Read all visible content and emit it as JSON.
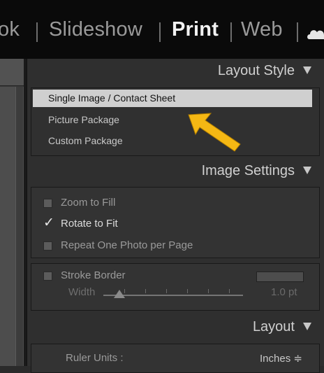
{
  "modules": [
    "ok",
    "Slideshow",
    "Print",
    "Web"
  ],
  "active_module": "Print",
  "layout_style": {
    "title": "Layout Style",
    "items": [
      "Single Image / Contact Sheet",
      "Picture Package",
      "Custom Package"
    ],
    "selected": "Single Image / Contact Sheet"
  },
  "image_settings": {
    "title": "Image Settings",
    "options": [
      {
        "label": "Zoom to Fill",
        "checked": false
      },
      {
        "label": "Rotate to Fit",
        "checked": true
      },
      {
        "label": "Repeat One Photo per Page",
        "checked": false
      }
    ],
    "stroke_border": {
      "label": "Stroke Border",
      "checked": false
    },
    "width": {
      "label": "Width",
      "value": "1.0 pt"
    }
  },
  "layout": {
    "title": "Layout",
    "ruler_units_label": "Ruler Units :",
    "ruler_units_value": "Inches ≑"
  },
  "colors": {
    "arrow": "#f5b814",
    "selected_bg": "#cfcfcf"
  },
  "icons": {
    "cloud": "cloud-icon",
    "arrow": "arrow-icon",
    "collapse": "triangle-down-icon"
  }
}
